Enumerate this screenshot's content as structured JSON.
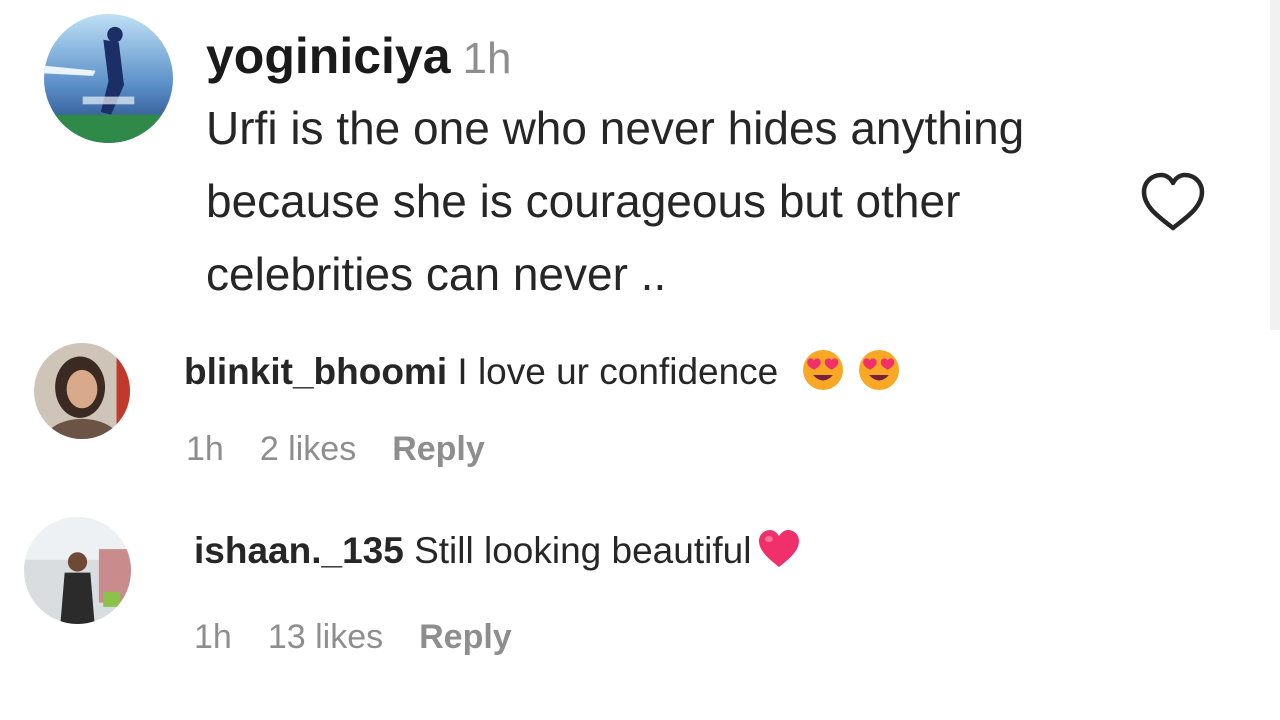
{
  "comment": {
    "username": "yoginiciya",
    "time": "1h",
    "text": "Urfi is the one who never hides anything because she is courageous but other celebrities can never ..",
    "like_icon": "heart-outline-icon"
  },
  "replies": [
    {
      "username": "blinkit_bhoomi",
      "text": "I love ur confidence",
      "emojis": [
        "heart-eyes-emoji-icon",
        "heart-eyes-emoji-icon"
      ],
      "time": "1h",
      "likes": "2 likes",
      "reply_label": "Reply"
    },
    {
      "username": "ishaan._135",
      "text": "Still looking beautiful",
      "emojis": [
        "red-heart-emoji-icon"
      ],
      "time": "1h",
      "likes": "13 likes",
      "reply_label": "Reply"
    }
  ],
  "colors": {
    "text": "#262626",
    "secondary": "#8e8e8e",
    "heart_outline": "#262626",
    "emoji_face": "#f9a825",
    "emoji_heart": "#f0306a"
  }
}
